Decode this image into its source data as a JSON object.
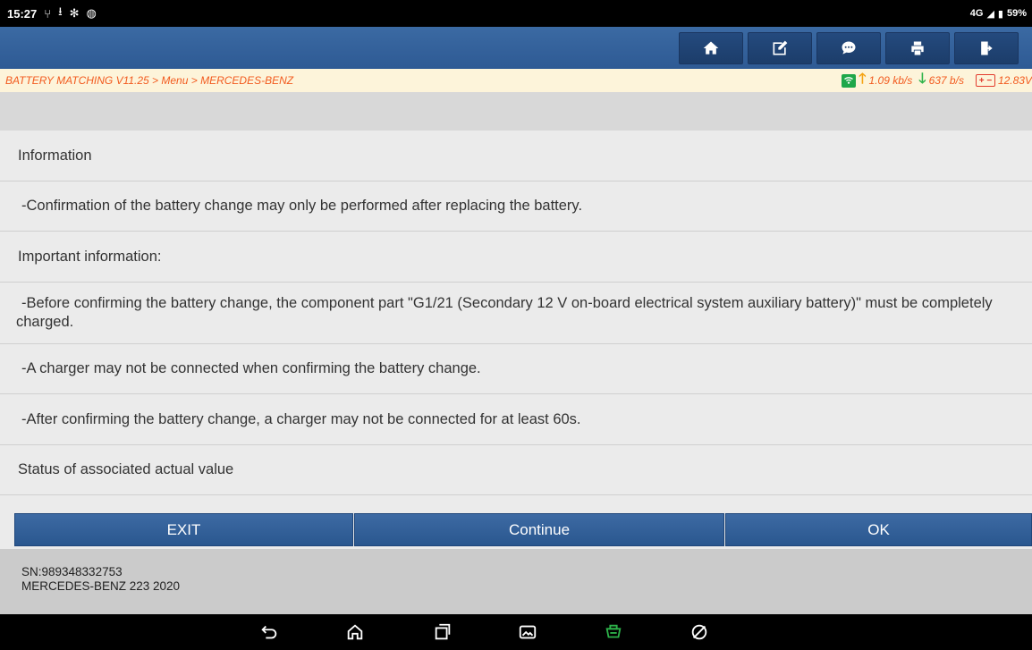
{
  "status_bar": {
    "time": "15:27",
    "left_icons": [
      "usb-icon",
      "download-icon",
      "bluetooth-icon",
      "chat-bubble-icon"
    ],
    "network": "4G",
    "battery": "59%"
  },
  "toolbar": {
    "buttons": [
      "home-icon",
      "edit-note-icon",
      "message-icon",
      "print-icon",
      "exit-door-icon"
    ]
  },
  "breadcrumb": {
    "path": "BATTERY MATCHING V11.25 > Menu > MERCEDES-BENZ",
    "upload": "1.09 kb/s",
    "download": "637 b/s",
    "voltage": "12.83V"
  },
  "content": {
    "rows": [
      "Information",
      "-Confirmation of the battery change may only be performed after replacing the battery.",
      "Important information:",
      "-Before confirming the battery change, the component part \"G1/21 (Secondary 12 V on-board electrical system auxiliary battery)\" must be completely charged.",
      "-A charger may not be connected when confirming the battery change.",
      "-After confirming the battery change, a charger may not be connected for at least 60s.",
      "Status of associated actual value"
    ]
  },
  "actions": {
    "exit_label": "EXIT",
    "continue_label": "Continue",
    "ok_label": "OK"
  },
  "footer": {
    "sn": "SN:989348332753",
    "vehicle": "MERCEDES-BENZ 223 2020"
  },
  "colors": {
    "toolbar": "#2e5a94",
    "button": "#2a578f",
    "breadcrumb_text": "#f25a1e",
    "vci_green": "#2db34a"
  }
}
